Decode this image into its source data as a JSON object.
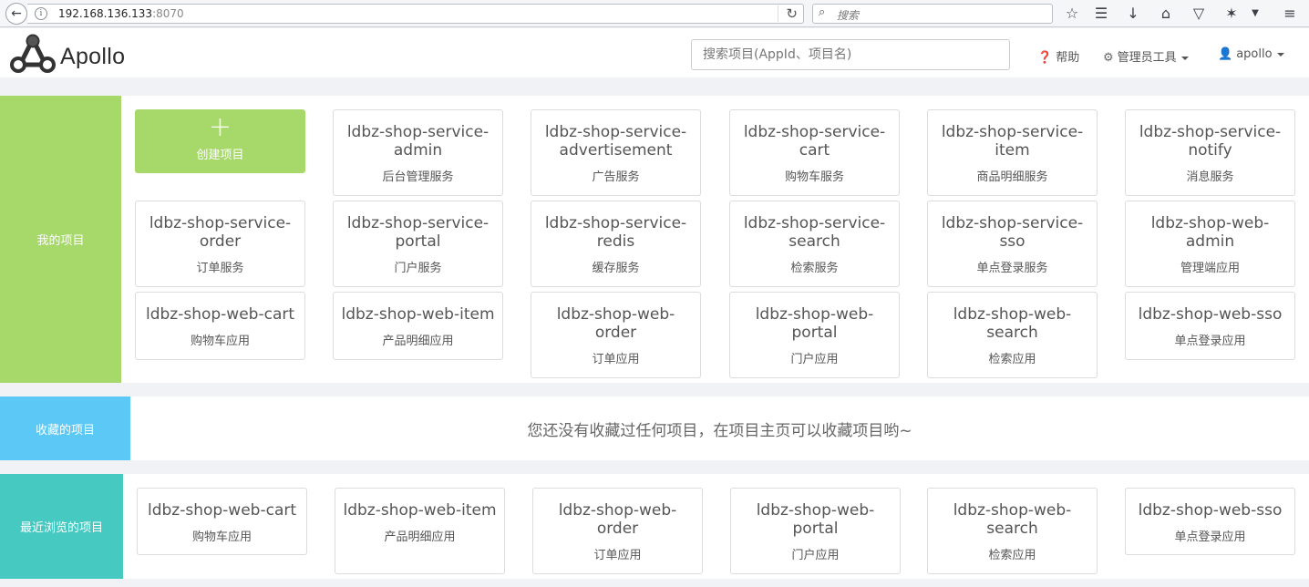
{
  "browser": {
    "url_host": "192.168.136.133",
    "url_port": ":8070",
    "search_placeholder": "搜索"
  },
  "header": {
    "logo_text": "Apollo",
    "search_placeholder": "搜索项目(AppId、项目名)",
    "help_label": "帮助",
    "admin_tools_label": "管理员工具",
    "user_label": "apollo"
  },
  "my_projects": {
    "label": "我的项目",
    "create_label": "创建项目",
    "items": [
      {
        "name": "ldbz-shop-service-admin",
        "desc": "后台管理服务"
      },
      {
        "name": "ldbz-shop-service-advertisement",
        "desc": "广告服务"
      },
      {
        "name": "ldbz-shop-service-cart",
        "desc": "购物车服务"
      },
      {
        "name": "ldbz-shop-service-item",
        "desc": "商品明细服务"
      },
      {
        "name": "ldbz-shop-service-notify",
        "desc": "消息服务"
      },
      {
        "name": "ldbz-shop-service-order",
        "desc": "订单服务"
      },
      {
        "name": "ldbz-shop-service-portal",
        "desc": "门户服务"
      },
      {
        "name": "ldbz-shop-service-redis",
        "desc": "缓存服务"
      },
      {
        "name": "ldbz-shop-service-search",
        "desc": "检索服务"
      },
      {
        "name": "ldbz-shop-service-sso",
        "desc": "单点登录服务"
      },
      {
        "name": "ldbz-shop-web-admin",
        "desc": "管理端应用"
      },
      {
        "name": "ldbz-shop-web-cart",
        "desc": "购物车应用"
      },
      {
        "name": "ldbz-shop-web-item",
        "desc": "产品明细应用"
      },
      {
        "name": "ldbz-shop-web-order",
        "desc": "订单应用"
      },
      {
        "name": "ldbz-shop-web-portal",
        "desc": "门户应用"
      },
      {
        "name": "ldbz-shop-web-search",
        "desc": "检索应用"
      },
      {
        "name": "ldbz-shop-web-sso",
        "desc": "单点登录应用"
      }
    ]
  },
  "favorites": {
    "label": "收藏的项目",
    "empty_message": "您还没有收藏过任何项目，在项目主页可以收藏项目哟~"
  },
  "recent": {
    "label": "最近浏览的项目",
    "items": [
      {
        "name": "ldbz-shop-web-cart",
        "desc": "购物车应用"
      },
      {
        "name": "ldbz-shop-web-item",
        "desc": "产品明细应用"
      },
      {
        "name": "ldbz-shop-web-order",
        "desc": "订单应用"
      },
      {
        "name": "ldbz-shop-web-portal",
        "desc": "门户应用"
      },
      {
        "name": "ldbz-shop-web-search",
        "desc": "检索应用"
      },
      {
        "name": "ldbz-shop-web-sso",
        "desc": "单点登录应用"
      }
    ]
  },
  "colors": {
    "my_projects": "#a6d96a",
    "favorites": "#5bc8f5",
    "recent": "#45c9c1"
  }
}
